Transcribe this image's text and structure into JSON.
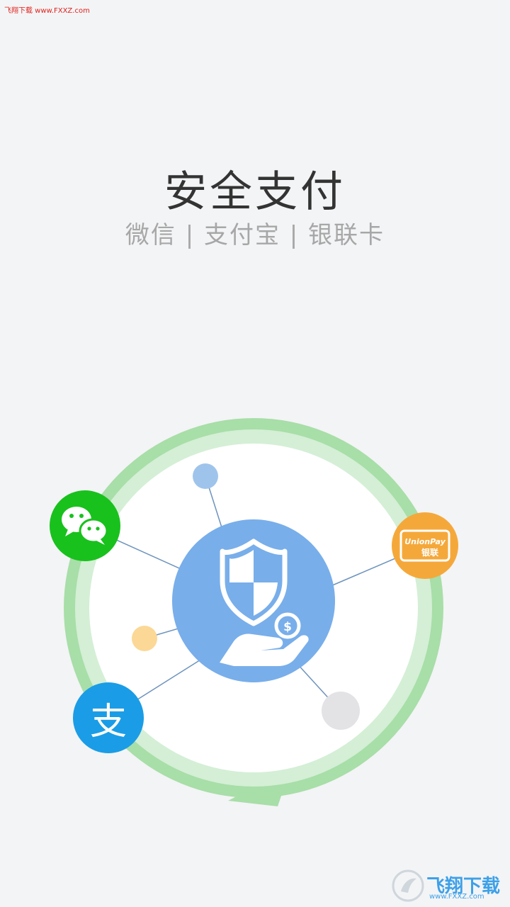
{
  "watermark": {
    "top_text": "飞翔下载 www.FXXZ.com",
    "bottom_logo": "飞翔下载",
    "bottom_url": "www.FXXZ.com"
  },
  "header": {
    "title": "安全支付",
    "subtitle": "微信 | 支付宝 | 银联卡"
  },
  "illustration": {
    "center_icon": "shield-hand-coin-icon",
    "coin_symbol": "$",
    "unionpay_label_top": "UnionPay",
    "unionpay_label_bottom": "银联",
    "alipay_glyph": "支",
    "colors": {
      "ring_outer": "#a8dea8",
      "ring_inner": "#d4efd6",
      "center": "#78aeea",
      "wechat": "#19c11d",
      "alipay": "#1a9de6",
      "unionpay": "#f5a83a",
      "dot_blue": "#9fc4ec",
      "dot_yellow": "#fbd895",
      "dot_gray": "#e3e3e6",
      "line": "#6d93bd"
    }
  }
}
